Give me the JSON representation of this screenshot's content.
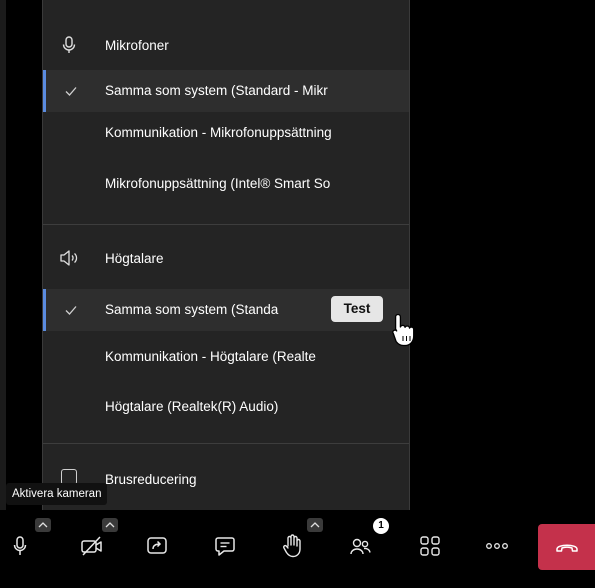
{
  "flyout": {
    "microphones": {
      "header": "Mikrofoner",
      "icon": "microphone-icon",
      "options": [
        {
          "label": "Samma som system (Standard - Mikr",
          "selected": true
        },
        {
          "label": "Kommunikation - Mikrofonuppsättning",
          "selected": false
        },
        {
          "label": "Mikrofonuppsättning (Intel® Smart So",
          "selected": false
        }
      ]
    },
    "speakers": {
      "header": "Högtalare",
      "icon": "speaker-icon",
      "options": [
        {
          "label": "Samma som system (Standa",
          "selected": true
        },
        {
          "label": "Kommunikation - Högtalare (Realte",
          "selected": false
        },
        {
          "label": "Högtalare (Realtek(R) Audio)",
          "selected": false
        }
      ],
      "test_button": "Test"
    },
    "noise_suppression": {
      "label": "Brusreducering",
      "visible_label": "educering",
      "checked": false
    }
  },
  "tooltip": "Aktivera kameran",
  "toolbar": {
    "buttons": [
      {
        "name": "microphone-button",
        "icon": "microphone-icon"
      },
      {
        "name": "camera-button",
        "icon": "camera-off-icon"
      },
      {
        "name": "share-button",
        "icon": "share-screen-icon"
      },
      {
        "name": "chat-button",
        "icon": "chat-icon"
      },
      {
        "name": "raise-hand-button",
        "icon": "hand-icon"
      },
      {
        "name": "participants-button",
        "icon": "people-icon"
      },
      {
        "name": "apps-button",
        "icon": "apps-grid-icon"
      },
      {
        "name": "more-button",
        "icon": "more-dots-icon"
      },
      {
        "name": "leave-button",
        "icon": "phone-hangup-icon"
      }
    ],
    "participants_badge": "1"
  },
  "colors": {
    "accent": "#5b8ce0",
    "flyout_bg": "#242424",
    "selected_bg": "#2e2e2e",
    "hangup": "#c4314b"
  }
}
